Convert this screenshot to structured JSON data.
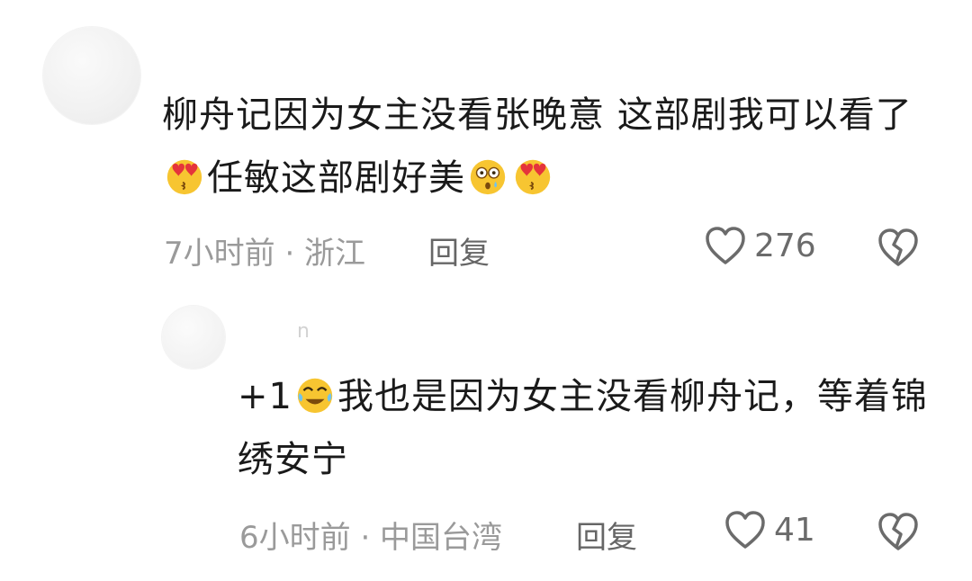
{
  "comments": [
    {
      "text_part1": "柳舟记因为女主没看张晚意  这部剧我可以看了",
      "text_part2": "任敏这部剧好美",
      "emojis": [
        "heart-eyes-kiss-emoji",
        "shocked-tear-emoji",
        "heart-eyes-kiss-emoji"
      ],
      "meta": "7小时前 · 浙江",
      "reply_label": "回复",
      "likes": "276"
    },
    {
      "username": "n",
      "text_prefix": "+1",
      "text_part1": "我也是因为女主没看柳舟记，等着锦绣安宁",
      "emojis": [
        "tears-of-joy-emoji"
      ],
      "meta": "6小时前 · 中国台湾",
      "reply_label": "回复",
      "likes": "41"
    }
  ],
  "colors": {
    "text": "#1a1a1a",
    "meta": "#9a9a9a",
    "icon": "#6b6b6b",
    "emoji_face": "#f7c531"
  }
}
